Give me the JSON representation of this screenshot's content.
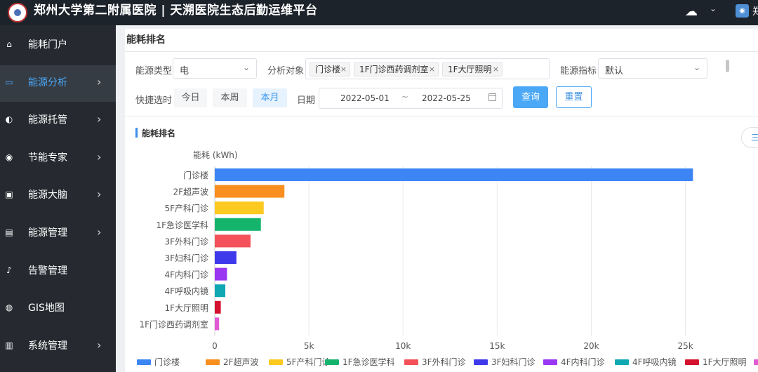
{
  "header": {
    "title": "郑州大学第二附属医院 | 天溯医院生态后勤运维平台",
    "user_initial": "郑"
  },
  "sidebar": {
    "items": [
      {
        "label": "能耗门户",
        "icon": "home-icon",
        "has_arrow": false,
        "active": false
      },
      {
        "label": "能源分析",
        "icon": "monitor-icon",
        "has_arrow": true,
        "active": true
      },
      {
        "label": "能源托管",
        "icon": "hosting-icon",
        "has_arrow": true,
        "active": false
      },
      {
        "label": "节能专家",
        "icon": "expert-icon",
        "has_arrow": true,
        "active": false
      },
      {
        "label": "能源大脑",
        "icon": "brain-icon",
        "has_arrow": true,
        "active": false
      },
      {
        "label": "能源管理",
        "icon": "management-icon",
        "has_arrow": true,
        "active": false
      },
      {
        "label": "告警管理",
        "icon": "bell-icon",
        "has_arrow": false,
        "active": false
      },
      {
        "label": "GIS地图",
        "icon": "globe-icon",
        "has_arrow": false,
        "active": false
      },
      {
        "label": "系统管理",
        "icon": "system-icon",
        "has_arrow": true,
        "active": false
      }
    ]
  },
  "panel": {
    "title": "能耗排名"
  },
  "filters": {
    "energy_type_label": "能源类型",
    "energy_type_value": "电",
    "target_label": "分析对象",
    "targets": [
      "门诊楼",
      "1F门诊西药调剂室",
      "1F大厅照明"
    ],
    "indicator_label": "能源指标",
    "indicator_value": "默认",
    "quick_label": "快捷选时",
    "quick_options": [
      "今日",
      "本周",
      "本月"
    ],
    "quick_selected": "本月",
    "date_label": "日期",
    "date_start": "2022-05-01",
    "date_sep": "~",
    "date_end": "2022-05-25",
    "query_label": "查询",
    "reset_label": "重置"
  },
  "section": {
    "title": "能耗排名",
    "menu_icon": "三"
  },
  "colors": {
    "accent": "#4aa8f7",
    "sidebar_bg": "#262a30",
    "header_bg": "#1d232b"
  },
  "chart_data": {
    "type": "bar",
    "orientation": "horizontal",
    "ylabel": "能耗  (kWh)",
    "categories": [
      "门诊楼",
      "2F超声波",
      "5F产科门诊",
      "1F急诊医学科",
      "3F外科门诊",
      "3F妇科门诊",
      "4F内科门诊",
      "4F呼吸内镜",
      "1F大厅照明",
      "1F门诊西药调剂室"
    ],
    "values": [
      25400,
      3700,
      2600,
      2450,
      1900,
      1150,
      650,
      560,
      320,
      230
    ],
    "colors": [
      "#3d85f5",
      "#f98f1e",
      "#fcc920",
      "#14b46c",
      "#f4515a",
      "#3f39ec",
      "#9a37f2",
      "#0fa8b3",
      "#d4112e",
      "#e15ad4"
    ],
    "xlim": [
      0,
      25500
    ],
    "xticks": [
      0,
      5000,
      10000,
      15000,
      20000,
      25000
    ],
    "xtick_labels": [
      "0",
      "5k",
      "10k",
      "15k",
      "20k",
      "25k"
    ],
    "grid": true,
    "legend": "bottom"
  }
}
